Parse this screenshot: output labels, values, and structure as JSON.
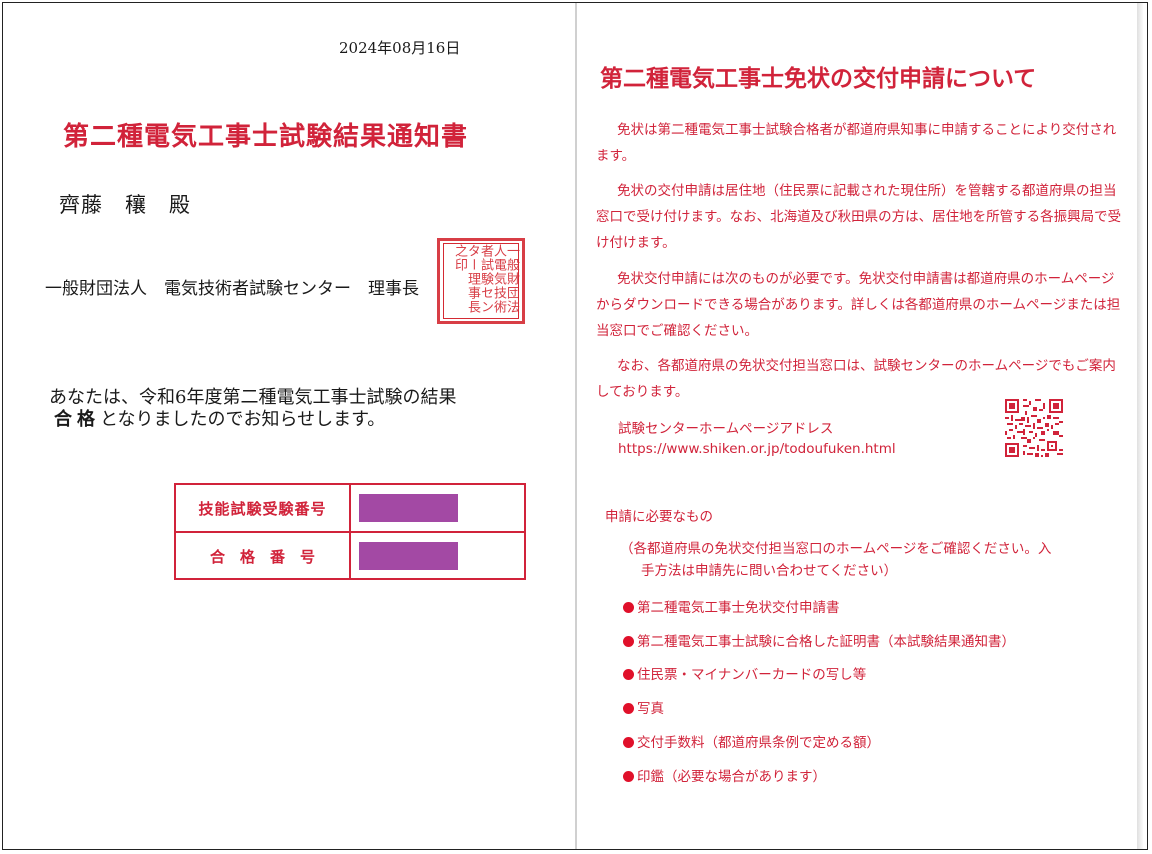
{
  "left_page": {
    "date": "2024年08月16日",
    "title": "第二種電気工事士試験結果通知書",
    "recipient": "齊藤　穰　殿",
    "issuer": "一般財団法人　電気技術者試験センター　理事長",
    "seal_text": "一般財団法人電気技術者試験センター理事長之印",
    "result_line1": "あなたは、令和6年度第二種電気工事士試験の結果",
    "result_pass": "合格",
    "result_line2_rest": "となりましたのでお知らせします。",
    "table": {
      "row1_label": "技能試験受験番号",
      "row2_label": "合格番号",
      "redaction_color": "#a349a4"
    }
  },
  "right_page": {
    "title": "第二種電気工事士免状の交付申請について",
    "paragraphs": [
      "免状は第二種電気工事士試験合格者が都道府県知事に申請することにより交付されます。",
      "免状の交付申請は居住地（住民票に記載された現住所）を管轄する都道府県の担当窓口で受け付けます。なお、北海道及び秋田県の方は、居住地を所管する各振興局で受け付けます。",
      "免状交付申請には次のものが必要です。免状交付申請書は都道府県のホームページからダウンロードできる場合があります。詳しくは各都道府県のホームページまたは担当窓口でご確認ください。",
      "なお、各都道府県の免状交付担当窓口は、試験センターのホームページでもご案内しております。"
    ],
    "address_label": "試験センターホームページアドレス",
    "address_url": "https://www.shiken.or.jp/todoufuken.html",
    "requirements_heading": "申請に必要なもの",
    "requirements_note_line1": "（各都道府県の免状交付担当窓口のホームページをご確認ください。入",
    "requirements_note_line2": "手方法は申請先に問い合わせてください）",
    "requirements": [
      "第二種電気工事士免状交付申請書",
      "第二種電気工事士試験に合格した証明書（本試験結果通知書）",
      "住民票・マイナンバーカードの写し等",
      "写真",
      "交付手数料（都道府県条例で定める額）",
      "印鑑（必要な場合があります）"
    ],
    "accent_color": "#d1233a"
  }
}
